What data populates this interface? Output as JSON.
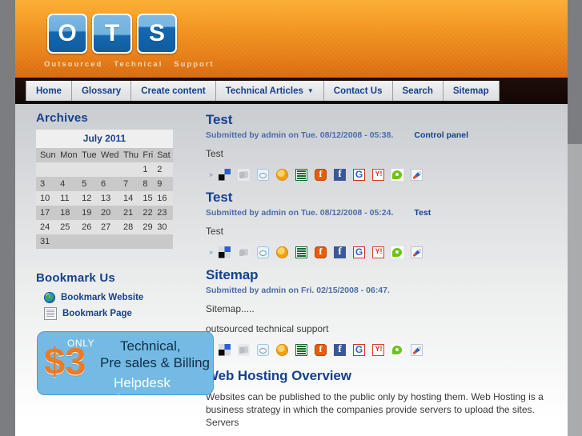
{
  "site": {
    "logo_letters": [
      "O",
      "T",
      "S"
    ],
    "tagline_words": [
      "Outsourced",
      "Technical",
      "Support"
    ]
  },
  "nav": {
    "items": [
      {
        "label": "Home",
        "has_caret": false
      },
      {
        "label": "Glossary",
        "has_caret": false
      },
      {
        "label": "Create content",
        "has_caret": false
      },
      {
        "label": "Technical Articles",
        "has_caret": true
      },
      {
        "label": "Contact Us",
        "has_caret": false
      },
      {
        "label": "Search",
        "has_caret": false
      },
      {
        "label": "Sitemap",
        "has_caret": false
      }
    ],
    "caret_glyph": "▼"
  },
  "sidebar": {
    "archives": {
      "title": "Archives",
      "month": "July 2011",
      "weekdays": [
        "Sun",
        "Mon",
        "Tue",
        "Wed",
        "Thu",
        "Fri",
        "Sat"
      ],
      "weeks": [
        [
          "",
          "",
          "",
          "",
          "",
          "1",
          "2"
        ],
        [
          "3",
          "4",
          "5",
          "6",
          "7",
          "8",
          "9"
        ],
        [
          "10",
          "11",
          "12",
          "13",
          "14",
          "15",
          "16"
        ],
        [
          "17",
          "18",
          "19",
          "20",
          "21",
          "22",
          "23"
        ],
        [
          "24",
          "25",
          "26",
          "27",
          "28",
          "29",
          "30"
        ],
        [
          "31",
          "",
          "",
          "",
          "",
          "",
          ""
        ]
      ]
    },
    "bookmark": {
      "title": "Bookmark Us",
      "items": [
        {
          "label": "Bookmark Website",
          "icon": "globe-icon"
        },
        {
          "label": "Bookmark Page",
          "icon": "page-icon"
        }
      ]
    },
    "ad": {
      "only": "ONLY",
      "price": "$3",
      "line1": "Technical,",
      "line2": "Pre sales & Billing",
      "line3": "Helpdesk Support"
    }
  },
  "social": {
    "bullet": "»",
    "icons": [
      "delicious-icon",
      "stumbleupon-icon",
      "reddit-icon",
      "mixx-icon",
      "newsvine-icon",
      "friendfeed-icon",
      "facebook-icon",
      "google-icon",
      "yahoo-icon",
      "technorati-icon",
      "rocket-icon"
    ]
  },
  "content": {
    "nodes": [
      {
        "title": "Test",
        "submitted": "Submitted by admin on Tue. 08/12/2008 - 05:38.",
        "link": "Control panel",
        "paragraphs": [
          "Test"
        ],
        "has_social": true
      },
      {
        "title": "Test",
        "submitted": "Submitted by admin on Tue. 08/12/2008 - 05:24.",
        "link": "Test",
        "paragraphs": [
          "Test"
        ],
        "has_social": true
      },
      {
        "title": "Sitemap",
        "submitted": "Submitted by admin on Fri. 02/15/2008 - 06:47.",
        "link": "",
        "paragraphs": [
          "Sitemap.....",
          "outsourced technical support"
        ],
        "has_social": true
      },
      {
        "title": "Web Hosting Overview",
        "submitted": "",
        "link": "",
        "paragraphs": [
          "Websites can be published to the public only by hosting them. Web Hosting is a business strategy in which the companies provide servers to upload the sites. Servers"
        ],
        "has_social": false
      }
    ]
  },
  "colors": {
    "brand_orange": "#f0921f",
    "link_blue": "#16418c",
    "nav_bar": "#190a06",
    "ad_blue": "#74bae4",
    "ad_orange": "#ef7a21"
  }
}
